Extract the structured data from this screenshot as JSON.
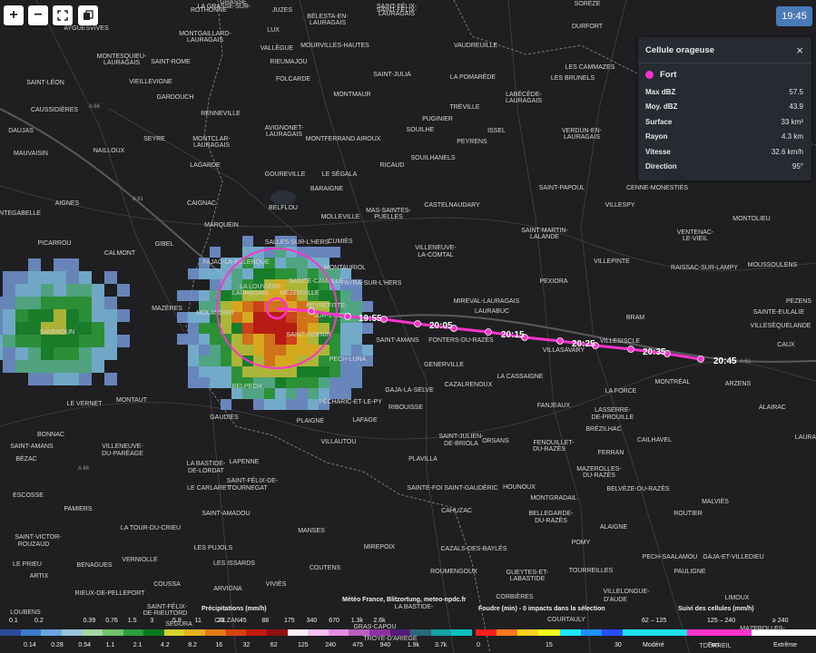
{
  "controls": {
    "zoom_in": "+",
    "zoom_out": "−",
    "time": "19:45"
  },
  "places": [
    [
      "GRASSE",
      "257",
      "4"
    ],
    [
      "ROTHONNE",
      "230",
      "13"
    ],
    [
      "LA GRASSE-SUR-",
      "247",
      "9"
    ],
    [
      "JUZES",
      "311",
      "13"
    ],
    [
      "SAINT-FÉLIX-",
      "437",
      "9"
    ],
    [
      "SAINT-FÉLIX-",
      "437",
      "13"
    ],
    [
      "LAURAGAIS",
      "437",
      "17"
    ],
    [
      "SORÈZE",
      "647",
      "6"
    ],
    [
      "DURFORT",
      "647",
      "31"
    ],
    [
      "LES CAMMAZES",
      "650",
      "76"
    ],
    [
      "BÉLESTA-EN-",
      "361",
      "20"
    ],
    [
      "LAURAGAIS",
      "361",
      "27"
    ],
    [
      "MONTGAILLARD-",
      "226",
      "39"
    ],
    [
      "LAURAGAIS",
      "226",
      "46"
    ],
    [
      "AYGUESVIVES",
      "95",
      "33"
    ],
    [
      "LUX",
      "301",
      "35"
    ],
    [
      "MOURVILLES-HAUTES",
      "369",
      "52"
    ],
    [
      "VAUDREUILLE",
      "524",
      "52"
    ],
    [
      "VALLÈGUE",
      "305",
      "55"
    ],
    [
      "MONTESQUIEU-",
      "134",
      "64"
    ],
    [
      "LAURAGAIS",
      "134",
      "71"
    ],
    [
      "SAINT-ROME",
      "188",
      "70"
    ],
    [
      "RIEUMAJOU",
      "318",
      "70"
    ],
    [
      "SAINT-JULIA",
      "432",
      "84"
    ],
    [
      "LA POMARÈDE",
      "521",
      "87"
    ],
    [
      "LES BRUNELS",
      "631",
      "88"
    ],
    [
      "SAINT-LÉON",
      "50",
      "93"
    ],
    [
      "VIEILLEVIGNE",
      "166",
      "92"
    ],
    [
      "FOLCARDE",
      "323",
      "89"
    ],
    [
      "MONTMAUR",
      "388",
      "106"
    ],
    [
      "GARDOUCH",
      "193",
      "109"
    ],
    [
      "LABÉCÈDE-",
      "577",
      "106"
    ],
    [
      "LAURAGAIS",
      "577",
      "113"
    ],
    [
      "CAUSSIDIÈRES",
      "60",
      "123"
    ],
    [
      "RENNEVILLE",
      "243",
      "127"
    ],
    [
      "TRÉVILLE",
      "512",
      "120"
    ],
    [
      "AVIGNONET-",
      "313",
      "143"
    ],
    [
      "LAURAGAIS",
      "313",
      "150"
    ],
    [
      "PUGINIER",
      "482",
      "133"
    ],
    [
      "SOUILHE",
      "463",
      "145"
    ],
    [
      "ISSEL",
      "547",
      "146"
    ],
    [
      "VERDUN-EN-",
      "641",
      "146"
    ],
    [
      "LAURAGAIS",
      "641",
      "153"
    ],
    [
      "DAUJAS",
      "23",
      "146"
    ],
    [
      "SEYRE",
      "170",
      "155"
    ],
    [
      "MONTCLAR-",
      "233",
      "155"
    ],
    [
      "LAURAGAIS",
      "233",
      "162"
    ],
    [
      "MONTFERRAND",
      "364",
      "155"
    ],
    [
      "AIROUX",
      "406",
      "155"
    ],
    [
      "PEYRENS",
      "520",
      "158"
    ],
    [
      "NAILLOUX",
      "120",
      "168"
    ],
    [
      "MAUVAISIN",
      "34",
      "171"
    ],
    [
      "SOUILHANELS",
      "477",
      "176"
    ],
    [
      "LAGARDE",
      "226",
      "184"
    ],
    [
      "RICAUD",
      "432",
      "184"
    ],
    [
      "GOUREVILLE",
      "314",
      "194"
    ],
    [
      "LE SÉGALA",
      "374",
      "194"
    ],
    [
      "SAINT-PAPOUL",
      "619",
      "209"
    ],
    [
      "CENNE-MONESTIÉS",
      "724",
      "209"
    ],
    [
      "BARAIGNE",
      "360",
      "210"
    ],
    [
      "CAIGNAC",
      "222",
      "226"
    ],
    [
      "AIGNES",
      "74",
      "226"
    ],
    [
      "BELFLOU",
      "312",
      "231"
    ],
    [
      "CASTELNAUDARY",
      "498",
      "228"
    ],
    [
      "VILLESPY",
      "683",
      "228"
    ],
    [
      "MONTOLIEU",
      "828",
      "243"
    ],
    [
      "MAS-SAINTES-",
      "428",
      "234"
    ],
    [
      "PUELLES",
      "428",
      "241"
    ],
    [
      "MOLLEVILLE",
      "375",
      "241"
    ],
    [
      "NTEGABELLE",
      "22",
      "237"
    ],
    [
      "MARQUEIN",
      "244",
      "250"
    ],
    [
      "SAINT-MARTIN-",
      "600",
      "256"
    ],
    [
      "LALANDE",
      "600",
      "263"
    ],
    [
      "VENTENAC-",
      "766",
      "258"
    ],
    [
      "LE-VIEIL",
      "766",
      "265"
    ],
    [
      "SALLES-SUR-L'HERS",
      "327",
      "269"
    ],
    [
      "CUMIÈS",
      "375",
      "268"
    ],
    [
      "GIBEL",
      "181",
      "271"
    ],
    [
      "PICARROU",
      "60",
      "270"
    ],
    [
      "CALMONT",
      "132",
      "281"
    ],
    [
      "VILLENEUVE-",
      "480",
      "275"
    ],
    [
      "LA-COMTAL",
      "480",
      "283"
    ],
    [
      "VILLEPINTE",
      "674",
      "290"
    ],
    [
      "MOUSSOULENS",
      "851",
      "294"
    ],
    [
      "RAISSAC-SUR-LAMPY",
      "776",
      "297"
    ],
    [
      "FAJAC-LA-RELENQUE",
      "260",
      "291"
    ],
    [
      "MONTAURIOL",
      "380",
      "297"
    ],
    [
      "PAYRA-SUR-L'HERS",
      "409",
      "314"
    ],
    [
      "SAINTE-CAMELLE",
      "348",
      "312"
    ],
    [
      "LA LOUVIÈRE-",
      "288",
      "318"
    ],
    [
      "LAURAGAIS",
      "276",
      "325"
    ],
    [
      "MÉZERVILLE",
      "330",
      "325"
    ],
    [
      "PEXIORA",
      "610",
      "312"
    ],
    [
      "MIREVAL-LAURAGAIS",
      "536",
      "334"
    ],
    [
      "LAURABUC",
      "542",
      "345"
    ],
    [
      "PEZENS",
      "880",
      "334"
    ],
    [
      "MAZÈRES",
      "184",
      "342"
    ],
    [
      "SAINTE-EULALIE",
      "858",
      "346"
    ],
    [
      "MOLANDIER",
      "237",
      "347"
    ],
    [
      "PEYREFITTE-",
      "360",
      "339"
    ],
    [
      "SUR-L'HERS",
      "366",
      "350"
    ],
    [
      "BRAM",
      "700",
      "352"
    ],
    [
      "VILLESÈQUELANDE",
      "860",
      "361"
    ],
    [
      "SAVERDUN",
      "63",
      "368"
    ],
    [
      "SAINT-AMANS",
      "438",
      "377"
    ],
    [
      "FONTERS-DU-RAZÈS",
      "508",
      "377"
    ],
    [
      "SAINT-SERNIN",
      "340",
      "371"
    ],
    [
      "VILLASAVARY",
      "621",
      "388"
    ],
    [
      "VILLESISCLE",
      "683",
      "378"
    ],
    [
      "CAUX",
      "866",
      "382"
    ],
    [
      "PECH-LUNA",
      "383",
      "398"
    ],
    [
      "GENERVILLE",
      "489",
      "404"
    ],
    [
      "LA CASSAIGNE",
      "573",
      "417"
    ],
    [
      "MONTRÉAL",
      "741",
      "423"
    ],
    [
      "ARZENS",
      "813",
      "425"
    ],
    [
      "BELPECH",
      "272",
      "428"
    ],
    [
      "GAJA-LA-SELVE",
      "451",
      "432"
    ],
    [
      "CAZALRENOUX",
      "516",
      "426"
    ],
    [
      "LA FORCE",
      "684",
      "433"
    ],
    [
      "MONTAUT",
      "145",
      "443"
    ],
    [
      "PÉCHARIC-ET-LE-PY",
      "386",
      "445"
    ],
    [
      "RIBOUISSE",
      "447",
      "451"
    ],
    [
      "FANJEAUX",
      "610",
      "449"
    ],
    [
      "ALAIRAC",
      "851",
      "451"
    ],
    [
      "LE VERNET",
      "93",
      "447"
    ],
    [
      "LASSERRE-",
      "675",
      "454"
    ],
    [
      "DE-PROUILLE",
      "675",
      "462"
    ],
    [
      "GAUDIÈS",
      "247",
      "462"
    ],
    [
      "PLAIGNE",
      "342",
      "466"
    ],
    [
      "LAFAGE",
      "402",
      "465"
    ],
    [
      "BRÉZILHAC",
      "665",
      "475"
    ],
    [
      "BONNAC",
      "56",
      "481"
    ],
    [
      "VILLAUTOU",
      "373",
      "489"
    ],
    [
      "SAINT-JULIEN-",
      "508",
      "483"
    ],
    [
      "DE-BRIOLA",
      "508",
      "491"
    ],
    [
      "ORSANS",
      "546",
      "488"
    ],
    [
      "FENOUILLET-",
      "610",
      "490"
    ],
    [
      "DU-RAZÈS",
      "605",
      "497"
    ],
    [
      "CAILHAVEL",
      "721",
      "487"
    ],
    [
      "SAINT-AMANS",
      "35",
      "494"
    ],
    [
      "VILLENEUVE-",
      "135",
      "494"
    ],
    [
      "DU-PARÉAGE",
      "135",
      "502"
    ],
    [
      "FERRAN",
      "673",
      "501"
    ],
    [
      "LAURAC",
      "890",
      "484"
    ],
    [
      "BÉZAC",
      "29",
      "508"
    ],
    [
      "PLAVILLA",
      "466",
      "508"
    ],
    [
      "LAPENNE",
      "269",
      "511"
    ],
    [
      "LA BASTIDE-",
      "227",
      "513"
    ],
    [
      "DE-LORDAT",
      "227",
      "521"
    ],
    [
      "MAZEROLLES-",
      "660",
      "519"
    ],
    [
      "DU-RAZÈS",
      "660",
      "526"
    ],
    [
      "ESCOSSE",
      "31",
      "548"
    ],
    [
      "LE CARLARET",
      "230",
      "540"
    ],
    [
      "SAINT-FÉLIX-DE-",
      "278",
      "532"
    ],
    [
      "TOURNEGAT",
      "273",
      "540"
    ],
    [
      "HOUNOUX",
      "572",
      "539"
    ],
    [
      "SAINT-GAUDÉRIC",
      "519",
      "540"
    ],
    [
      "BELVÈZE-DU-RAZÈS",
      "703",
      "541"
    ],
    [
      "SAINTE-FOI",
      "468",
      "540"
    ],
    [
      "MONTGRADAIL",
      "610",
      "551"
    ],
    [
      "MALVIÈS",
      "788",
      "555"
    ],
    [
      "PAMIERS",
      "86",
      "563"
    ],
    [
      "SAINT-AMADOU",
      "249",
      "568"
    ],
    [
      "CAHUZAC",
      "503",
      "565"
    ],
    [
      "BELLEGARDE-",
      "607",
      "568"
    ],
    [
      "DU-RAZÈS",
      "607",
      "576"
    ],
    [
      "ROUTIER",
      "758",
      "568"
    ],
    [
      "SAINT-VICTOR-",
      "42",
      "594"
    ],
    [
      "ROUZAUD",
      "37",
      "602"
    ],
    [
      "LA TOUR-DU-CRIEU",
      "166",
      "584"
    ],
    [
      "MANSES",
      "343",
      "587"
    ],
    [
      "ALAIGNE",
      "676",
      "583"
    ],
    [
      "LES PUJOLS",
      "235",
      "606"
    ],
    [
      "MIREPOIX",
      "418",
      "605"
    ],
    [
      "CAZALS-DES-BAYLÉS",
      "522",
      "607"
    ],
    [
      "POMY",
      "640",
      "600"
    ],
    [
      "PECH-SAALAMOU",
      "738",
      "616"
    ],
    [
      "GAJA-ET-VILLEDIEU",
      "808",
      "616"
    ],
    [
      "VERNIOLLE",
      "154",
      "619"
    ],
    [
      "LES ISSARDS",
      "258",
      "623"
    ],
    [
      "LE PRIEU",
      "30",
      "624"
    ],
    [
      "BENAGUES",
      "104",
      "625"
    ],
    [
      "COUTENS",
      "358",
      "628"
    ],
    [
      "ROUMENGOUX",
      "500",
      "632"
    ],
    [
      "GUEYTES-ET-",
      "581",
      "633"
    ],
    [
      "LABASTIDE",
      "581",
      "640"
    ],
    [
      "TOURREILLES",
      "651",
      "631"
    ],
    [
      "PAULIGNE",
      "760",
      "632"
    ],
    [
      "ARTIX",
      "43",
      "637"
    ],
    [
      "COUSSA",
      "184",
      "646"
    ],
    [
      "VIVIÈS",
      "304",
      "646"
    ],
    [
      "LIMOUX",
      "812",
      "661"
    ],
    [
      "RIEUX-DE-PELLEPORT",
      "121",
      "656"
    ],
    [
      "ARVIGNA",
      "251",
      "651"
    ],
    [
      "CORBIÈRES",
      "567",
      "660"
    ],
    [
      "VILLELONGUE-",
      "690",
      "654"
    ],
    [
      "D'AUDE",
      "678",
      "663"
    ],
    [
      "LOUBENS",
      "28",
      "677"
    ],
    [
      "SAINT-FÉLIX-",
      "184",
      "671"
    ],
    [
      "DE-RIEUTORD",
      "182",
      "678"
    ],
    [
      "LA BASTIDE-",
      "456",
      "671"
    ],
    [
      "SÉGURA",
      "197",
      "690"
    ],
    [
      "CALZAN",
      "250",
      "686"
    ],
    [
      "GRAS-CAPOU",
      "413",
      "693"
    ],
    [
      "COURTAULY",
      "624",
      "685"
    ],
    [
      "TROYE-D'ARIÈGE",
      "430",
      "706"
    ],
    [
      "TOURREIL",
      "788",
      "714"
    ],
    [
      "MAZEROLLES-",
      "840",
      "695"
    ]
  ],
  "track_labels": [
    "19:55",
    "20:05",
    "20:15",
    "20:25",
    "20:35",
    "20:45"
  ],
  "panel": {
    "title": "Cellule orageuse",
    "close": "×",
    "category": "Fort",
    "category_color": "#ff33cc",
    "rows": [
      {
        "key": "Max dBZ",
        "value": "57.5"
      },
      {
        "key": "Moy. dBZ",
        "value": "43.9"
      },
      {
        "key": "Surface",
        "value": "33 km²"
      },
      {
        "key": "Rayon",
        "value": "4.3 km"
      },
      {
        "key": "Vitesse",
        "value": "32.6 km/h"
      },
      {
        "key": "Direction",
        "value": "95°"
      }
    ]
  },
  "legend": {
    "credit": "Météo France, Blitzortung, meteo-npdc.fr",
    "precip_title": "Précipitations (mm/h)",
    "lightning_title": "Foudre (min) - 0 impacts dans la sélection",
    "tracking_title": "Suivi des cellules (mm/h)",
    "precip_top": [
      "0.1",
      "0.39",
      "0.76",
      "1.5",
      "3",
      "5.8",
      "11",
      "23",
      "45",
      "88",
      "175",
      "340",
      "670",
      "1.3k",
      "2.6k"
    ],
    "precip_bottom": [
      "0.14",
      "0.28",
      "0.54",
      "1.1",
      "2.1",
      "4.2",
      "8.2",
      "16",
      "32",
      "62",
      "125",
      "240",
      "475",
      "940",
      "1.9k",
      "3.7k"
    ],
    "precip_colors": [
      "#2d4a9a",
      "#3a7bc8",
      "#6aa5e0",
      "#9cc3dc",
      "#a7d6a2",
      "#6fc46a",
      "#2d9e3a",
      "#0b7a1f",
      "#d8d22c",
      "#e8b01e",
      "#e27a17",
      "#d84310",
      "#c21a0d",
      "#901010",
      "#fff0fa",
      "#f7c0f0",
      "#e38ee0",
      "#ba5fc0",
      "#9030a8",
      "#561b7a",
      "#2a6878",
      "#14a0a0",
      "#0ac0c0"
    ],
    "lightning_labels": [
      "0",
      "15",
      "30"
    ],
    "lightning_colors": [
      "#ff1d1d",
      "#ff7a1a",
      "#ffd21a",
      "#f5ff1a",
      "#1de8ff",
      "#1e90ff",
      "#2650ff"
    ],
    "tracking_labels": [
      "Modéré",
      "Fort",
      "Extrême"
    ],
    "tracking_ranges": [
      "62 – 125",
      "125 – 240",
      "≥ 240"
    ],
    "tracking_colors": [
      "#1de2ef",
      "#ff33cc",
      "#ffffff"
    ],
    "extra_top": "0.2"
  }
}
